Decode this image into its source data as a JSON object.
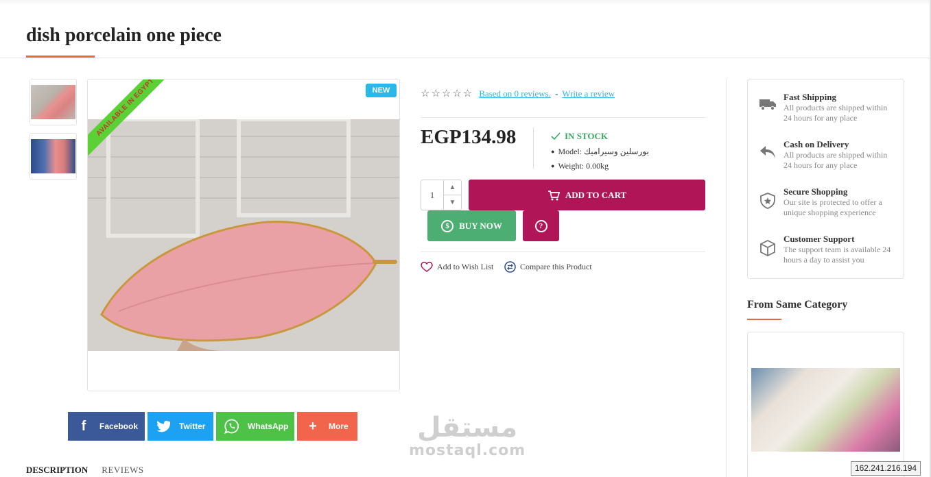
{
  "page": {
    "title": "dish porcelain one piece"
  },
  "gallery": {
    "thumbs": [
      "thumb-leaf-plate-pink",
      "thumb-leaf-plate-blue"
    ],
    "badge_new": "NEW",
    "ribbon": "AVAILABLE IN EGYPT"
  },
  "rating": {
    "stars": "☆☆☆☆☆",
    "reviews_link": "Based on 0 reviews.",
    "separator": "-",
    "write_review": "Write a review"
  },
  "product": {
    "price": "EGP134.98",
    "stock": "IN STOCK",
    "model": "Model: بورسلين وسيراميك",
    "weight": "Weight: 0.00kg",
    "quantity": "1"
  },
  "actions": {
    "add_to_cart": "ADD TO CART",
    "buy_now": "BUY NOW",
    "question_symbol": "?",
    "wishlist": "Add to Wish List",
    "compare": "Compare this Product"
  },
  "features": [
    {
      "icon": "truck-icon",
      "title": "Fast Shipping",
      "desc": "All products are shipped within 24 hours for any place"
    },
    {
      "icon": "reply-icon",
      "title": "Cash on Delivery",
      "desc": "All products are shipped within 24 hours for any place"
    },
    {
      "icon": "shield-icon",
      "title": "Secure Shopping",
      "desc": "Our site is protected to offer a unique shopping experience"
    },
    {
      "icon": "box-icon",
      "title": "Customer Support",
      "desc": "The support team is available 24 hours a day to assist you"
    }
  ],
  "same_category": {
    "title": "From Same Category"
  },
  "share": {
    "facebook": "Facebook",
    "twitter": "Twitter",
    "whatsapp": "WhatsApp",
    "more": "More"
  },
  "tabs": {
    "description": "DESCRIPTION",
    "reviews": "REVIEWS"
  },
  "watermark": {
    "arabic": "مستقل",
    "latin": "mostaql.com"
  },
  "ip": "162.241.216.194",
  "colors": {
    "accent": "#b01557",
    "buy_now": "#4cae72",
    "underline": "#e06b3c",
    "stock": "#39a85e",
    "link": "#2ab8e6"
  }
}
